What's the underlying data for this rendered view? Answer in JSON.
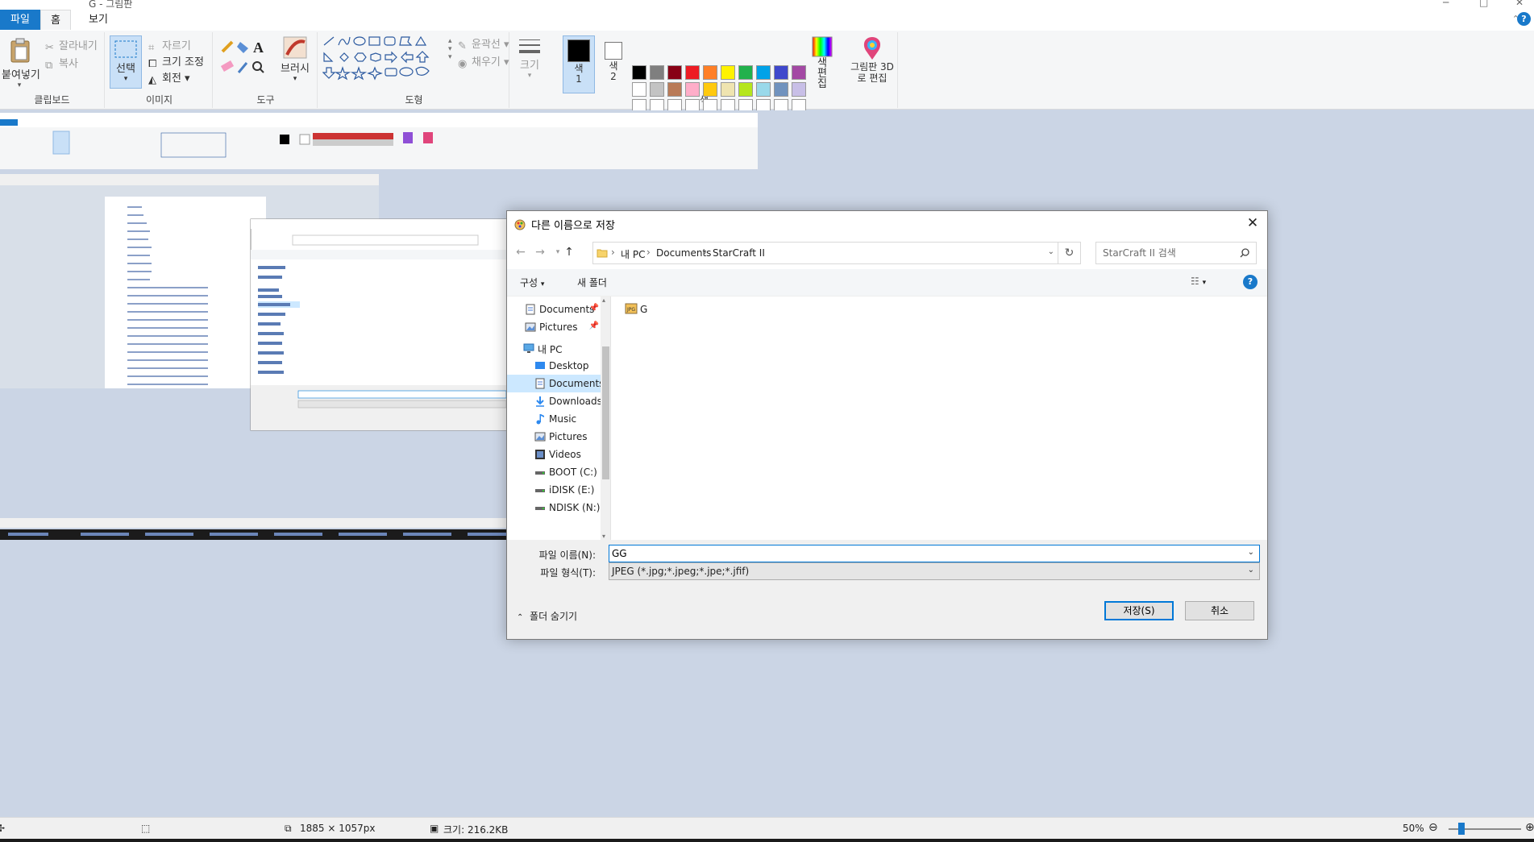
{
  "window": {
    "title": "G - 그림판"
  },
  "tabs": {
    "file": "파일",
    "home": "홈",
    "view": "보기"
  },
  "ribbon": {
    "clipboard": {
      "label": "클립보드",
      "paste": "붙여넣기",
      "cut": "잘라내기",
      "copy": "복사"
    },
    "image": {
      "label": "이미지",
      "select": "선택",
      "crop": "자르기",
      "resize": "크기 조정",
      "rotate": "회전"
    },
    "tools": {
      "label": "도구",
      "brushes": "브러시"
    },
    "shapes": {
      "label": "도형",
      "outline": "윤곽선",
      "fill": "채우기"
    },
    "size": "크기",
    "color1": "색 1",
    "color2": "색 2",
    "colors_label": "색",
    "edit_colors": "색 편집",
    "paint3d": "그림판 3D로 편집",
    "palette": [
      "#000000",
      "#7f7f7f",
      "#880015",
      "#ed1c24",
      "#ff7f27",
      "#fff200",
      "#22b14c",
      "#00a2e8",
      "#3f48cc",
      "#a349a4",
      "#ffffff",
      "#c3c3c3",
      "#b97a57",
      "#ffaec9",
      "#ffc90e",
      "#efe4b0",
      "#b5e61d",
      "#99d9ea",
      "#7092be",
      "#c8bfe7"
    ]
  },
  "dialog": {
    "title": "다른 이름으로 저장",
    "path": [
      "내 PC",
      "Documents",
      "StarCraft II"
    ],
    "search_placeholder": "StarCraft II 검색",
    "organize": "구성",
    "new_folder": "새 폴더",
    "nav": [
      {
        "label": "Documents",
        "icon": "documents-icon",
        "pinned": true
      },
      {
        "label": "Pictures",
        "icon": "pictures-icon",
        "pinned": true
      },
      {
        "label": "내 PC",
        "icon": "pc-icon"
      },
      {
        "label": "Desktop",
        "icon": "desktop-icon"
      },
      {
        "label": "Documents",
        "icon": "documents-icon",
        "selected": true
      },
      {
        "label": "Downloads",
        "icon": "downloads-icon"
      },
      {
        "label": "Music",
        "icon": "music-icon"
      },
      {
        "label": "Pictures",
        "icon": "pictures-icon"
      },
      {
        "label": "Videos",
        "icon": "videos-icon"
      },
      {
        "label": "BOOT (C:)",
        "icon": "drive-icon"
      },
      {
        "label": "iDISK (E:)",
        "icon": "drive-icon"
      },
      {
        "label": "NDISK (N:)",
        "icon": "drive-icon"
      }
    ],
    "files": [
      {
        "name": "G",
        "icon": "jpeg-file-icon"
      }
    ],
    "filename_label": "파일 이름(N):",
    "filename_value": "GG",
    "filetype_label": "파일 형식(T):",
    "filetype_value": "JPEG (*.jpg;*.jpeg;*.jpe;*.jfif)",
    "hide_folders": "폴더 숨기기",
    "save": "저장(S)",
    "cancel": "취소"
  },
  "status": {
    "dimensions": "1885 × 1057px",
    "size": "크기: 216.2KB",
    "zoom": "50%",
    "zoom_level_percent": 50
  },
  "colors": {
    "accent": "#1979ca",
    "selection": "#cce8ff",
    "workspace": "#cbd5e5"
  }
}
